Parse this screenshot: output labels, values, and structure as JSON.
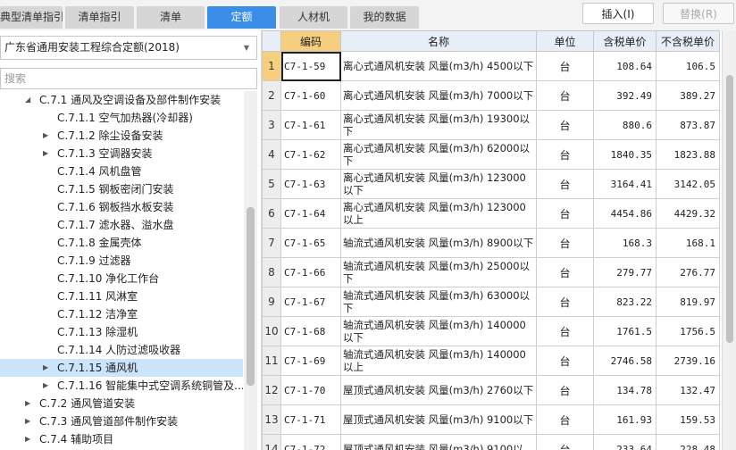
{
  "tabs": [
    {
      "label": "典型清单指引",
      "active": false
    },
    {
      "label": "清单指引",
      "active": false
    },
    {
      "label": "清单",
      "active": false
    },
    {
      "label": "定额",
      "active": true
    },
    {
      "label": "人材机",
      "active": false
    },
    {
      "label": "我的数据",
      "active": false
    }
  ],
  "buttons": {
    "insert": "插入(I)",
    "replace": "替换(R)"
  },
  "left": {
    "library": "广东省通用安装工程综合定额(2018)",
    "search_placeholder": "搜索",
    "tree": [
      {
        "label": "C.7.1 通风及空调设备及部件制作安装",
        "level": 1,
        "caret": "down",
        "selected": false
      },
      {
        "label": "C.7.1.1 空气加热器(冷却器)",
        "level": 2,
        "caret": "",
        "selected": false
      },
      {
        "label": "C.7.1.2 除尘设备安装",
        "level": 2,
        "caret": "right",
        "selected": false
      },
      {
        "label": "C.7.1.3 空调器安装",
        "level": 2,
        "caret": "right",
        "selected": false
      },
      {
        "label": "C.7.1.4 风机盘管",
        "level": 2,
        "caret": "",
        "selected": false
      },
      {
        "label": "C.7.1.5 钢板密闭门安装",
        "level": 2,
        "caret": "",
        "selected": false
      },
      {
        "label": "C.7.1.6 钢板挡水板安装",
        "level": 2,
        "caret": "",
        "selected": false
      },
      {
        "label": "C.7.1.7 滤水器、溢水盘",
        "level": 2,
        "caret": "",
        "selected": false
      },
      {
        "label": "C.7.1.8 金属壳体",
        "level": 2,
        "caret": "",
        "selected": false
      },
      {
        "label": "C.7.1.9 过滤器",
        "level": 2,
        "caret": "",
        "selected": false
      },
      {
        "label": "C.7.1.10 净化工作台",
        "level": 2,
        "caret": "",
        "selected": false
      },
      {
        "label": "C.7.1.11 风淋室",
        "level": 2,
        "caret": "",
        "selected": false
      },
      {
        "label": "C.7.1.12 洁净室",
        "level": 2,
        "caret": "",
        "selected": false
      },
      {
        "label": "C.7.1.13 除湿机",
        "level": 2,
        "caret": "",
        "selected": false
      },
      {
        "label": "C.7.1.14 人防过滤吸收器",
        "level": 2,
        "caret": "",
        "selected": false
      },
      {
        "label": "C.7.1.15 通风机",
        "level": 2,
        "caret": "right",
        "selected": true
      },
      {
        "label": "C.7.1.16 智能集中式空调系统铜管及...",
        "level": 2,
        "caret": "right",
        "selected": false
      },
      {
        "label": "C.7.2 通风管道安装",
        "level": 1,
        "caret": "right",
        "selected": false
      },
      {
        "label": "C.7.3 通风管道部件制作安装",
        "level": 1,
        "caret": "right",
        "selected": false
      },
      {
        "label": "C.7.4 辅助项目",
        "level": 1,
        "caret": "right",
        "selected": false
      }
    ]
  },
  "grid": {
    "headers": {
      "code": "编码",
      "name": "名称",
      "unit": "单位",
      "tax_in": "含税单价",
      "tax_ex": "不含税单价"
    },
    "rows": [
      {
        "no": "1",
        "code": "C7-1-59",
        "name": "离心式通风机安装 风量(m3/h) 4500以下",
        "unit": "台",
        "tax_in": "108.64",
        "tax_ex": "106.5"
      },
      {
        "no": "2",
        "code": "C7-1-60",
        "name": "离心式通风机安装 风量(m3/h) 7000以下",
        "unit": "台",
        "tax_in": "392.49",
        "tax_ex": "389.27"
      },
      {
        "no": "3",
        "code": "C7-1-61",
        "name": "离心式通风机安装 风量(m3/h) 19300以下",
        "unit": "台",
        "tax_in": "880.6",
        "tax_ex": "873.87"
      },
      {
        "no": "4",
        "code": "C7-1-62",
        "name": "离心式通风机安装 风量(m3/h) 62000以下",
        "unit": "台",
        "tax_in": "1840.35",
        "tax_ex": "1823.88"
      },
      {
        "no": "5",
        "code": "C7-1-63",
        "name": "离心式通风机安装 风量(m3/h) 123000以下",
        "unit": "台",
        "tax_in": "3164.41",
        "tax_ex": "3142.05"
      },
      {
        "no": "6",
        "code": "C7-1-64",
        "name": "离心式通风机安装 风量(m3/h) 123000以上",
        "unit": "台",
        "tax_in": "4454.86",
        "tax_ex": "4429.32"
      },
      {
        "no": "7",
        "code": "C7-1-65",
        "name": "轴流式通风机安装 风量(m3/h) 8900以下",
        "unit": "台",
        "tax_in": "168.3",
        "tax_ex": "168.1"
      },
      {
        "no": "8",
        "code": "C7-1-66",
        "name": "轴流式通风机安装 风量(m3/h) 25000以下",
        "unit": "台",
        "tax_in": "279.77",
        "tax_ex": "276.77"
      },
      {
        "no": "9",
        "code": "C7-1-67",
        "name": "轴流式通风机安装 风量(m3/h) 63000以下",
        "unit": "台",
        "tax_in": "823.22",
        "tax_ex": "819.97"
      },
      {
        "no": "10",
        "code": "C7-1-68",
        "name": "轴流式通风机安装 风量(m3/h) 140000以下",
        "unit": "台",
        "tax_in": "1761.5",
        "tax_ex": "1756.5"
      },
      {
        "no": "11",
        "code": "C7-1-69",
        "name": "轴流式通风机安装 风量(m3/h) 140000以上",
        "unit": "台",
        "tax_in": "2746.58",
        "tax_ex": "2739.16"
      },
      {
        "no": "12",
        "code": "C7-1-70",
        "name": "屋顶式通风机安装 风量(m3/h) 2760以下",
        "unit": "台",
        "tax_in": "134.78",
        "tax_ex": "132.47"
      },
      {
        "no": "13",
        "code": "C7-1-71",
        "name": "屋顶式通风机安装 风量(m3/h) 9100以下",
        "unit": "台",
        "tax_in": "161.93",
        "tax_ex": "159.53"
      },
      {
        "no": "14",
        "code": "C7-1-72",
        "name": "屋顶式通风机安装 风量(m3/h) 9100以",
        "unit": "台",
        "tax_in": "233.64",
        "tax_ex": "228.48"
      }
    ]
  }
}
